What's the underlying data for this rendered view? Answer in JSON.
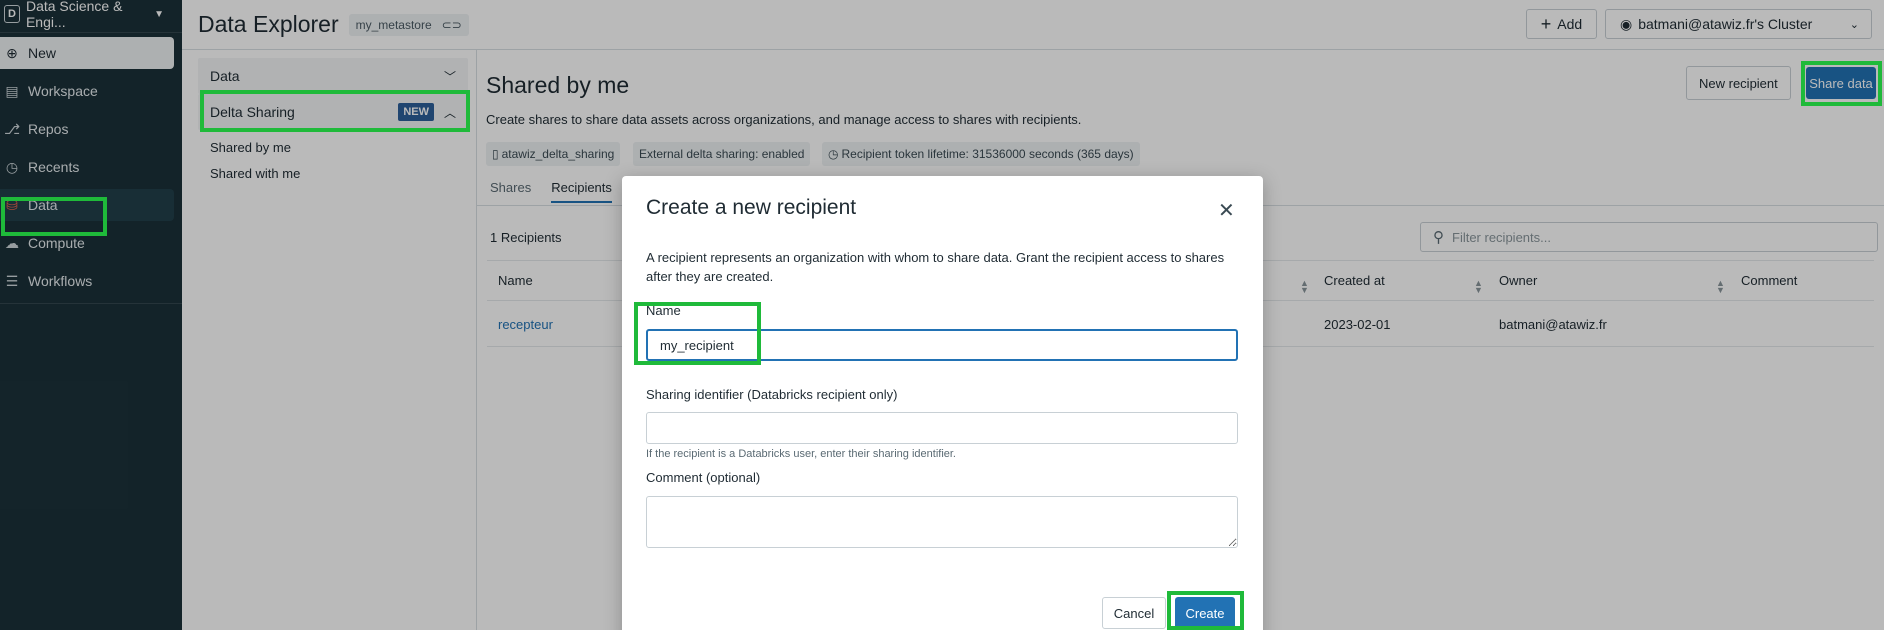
{
  "sidebar": {
    "workspace_logo": "D",
    "workspace_name": "Data Science & Engi...",
    "items": [
      {
        "label": "New",
        "icon": "plus-circle-icon"
      },
      {
        "label": "Workspace",
        "icon": "workspace-icon"
      },
      {
        "label": "Repos",
        "icon": "repos-icon"
      },
      {
        "label": "Recents",
        "icon": "clock-icon"
      },
      {
        "label": "Data",
        "icon": "data-icon"
      },
      {
        "label": "Compute",
        "icon": "compute-icon"
      },
      {
        "label": "Workflows",
        "icon": "workflows-icon"
      }
    ]
  },
  "header": {
    "title": "Data Explorer",
    "metastore": "my_metastore",
    "add_label": "Add",
    "cluster_label": "batmani@atawiz.fr's Cluster"
  },
  "explorer": {
    "data_section": "Data",
    "delta_section": "Delta Sharing",
    "new_badge": "NEW",
    "links": [
      "Shared by me",
      "Shared with me"
    ]
  },
  "main": {
    "title": "Shared by me",
    "description": "Create shares to share data assets across organizations, and manage access to shares with recipients.",
    "new_recipient_label": "New recipient",
    "share_data_label": "Share data",
    "tags": [
      "atawiz_delta_sharing",
      "External delta sharing: enabled",
      "Recipient token lifetime: 31536000 seconds (365 days)"
    ],
    "tabs": [
      "Shares",
      "Recipients"
    ],
    "recipient_count": "1 Recipients",
    "filter_placeholder": "Filter recipients...",
    "columns": [
      "Name",
      "Created at",
      "Owner",
      "Comment"
    ],
    "rows": [
      {
        "name": "recepteur",
        "created_at": "2023-02-01",
        "owner": "batmani@atawiz.fr",
        "comment": ""
      }
    ]
  },
  "modal": {
    "title": "Create a new recipient",
    "description": "A recipient represents an organization with whom to share data. Grant the recipient access to shares after they are created.",
    "name_label": "Name",
    "name_value": "my_recipient",
    "sharing_label": "Sharing identifier (Databricks recipient only)",
    "sharing_value": "",
    "sharing_hint": "If the recipient is a Databricks user, enter their sharing identifier.",
    "comment_label": "Comment (optional)",
    "comment_value": "",
    "cancel_label": "Cancel",
    "create_label": "Create"
  },
  "colors": {
    "sidebar_bg": "#1b3139",
    "accent": "#2272b4",
    "highlight": "#1fba3a",
    "badge": "#2c5f9a"
  }
}
